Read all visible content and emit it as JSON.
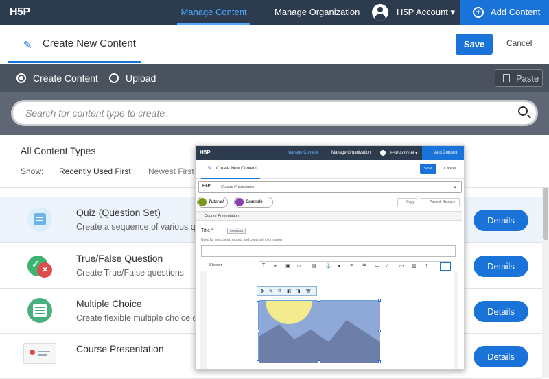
{
  "header": {
    "logo": "H5P",
    "nav": [
      "Manage Content",
      "Manage Organization"
    ],
    "account": "H5P Account ▾",
    "add_content": "Add Content"
  },
  "titlebar": {
    "title": "Create New Content",
    "save": "Save",
    "cancel": "Cancel"
  },
  "hub": {
    "create_label": "Create Content",
    "upload_label": "Upload",
    "paste_label": "Paste",
    "search_placeholder": "Search for content type to create"
  },
  "list": {
    "heading": "All Content Types",
    "show_label": "Show:",
    "sort_options": [
      "Recently Used First",
      "Newest First"
    ],
    "items": [
      {
        "name": "Quiz (Question Set)",
        "desc": "Create a sequence of various question types",
        "details": "Details"
      },
      {
        "name": "True/False Question",
        "desc": "Create True/False questions",
        "details": "Details"
      },
      {
        "name": "Multiple Choice",
        "desc": "Create flexible multiple choice questions",
        "details": "Details"
      },
      {
        "name": "Course Presentation",
        "desc": "",
        "details": "Details"
      }
    ]
  },
  "overlay": {
    "logo": "H5P",
    "nav": [
      "Manage Content",
      "Manage Organization"
    ],
    "account": "H5P Account ▾",
    "add_content": "Add Content",
    "title": "Create New Content",
    "save": "Save",
    "cancel": "Cancel",
    "content_type_logo": "H5P",
    "content_type": "Course Presentation",
    "tutorial": "Tutorial",
    "example": "Example",
    "copy": "Copy",
    "paste_replace": "Paste & Replace",
    "section": "Course Presentation",
    "field_title": "Title *",
    "metadata": "Metadata",
    "hint": "Used for searching, reports and copyright information",
    "slides": "Slides ▾"
  },
  "colors": {
    "brand_blue": "#1a73d9",
    "topbar": "#2c3b4e",
    "hub_gray": "#5e6773"
  }
}
